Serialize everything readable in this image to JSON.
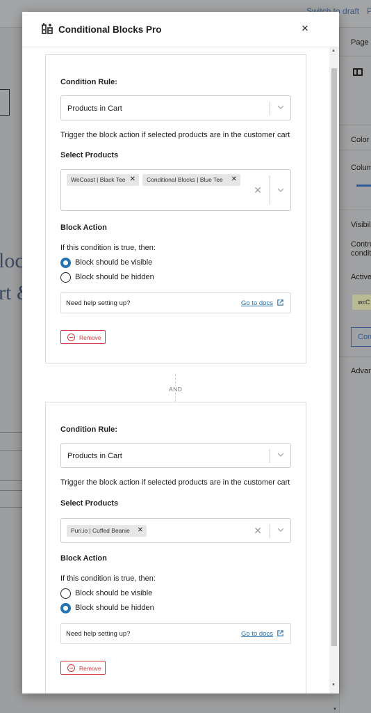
{
  "background": {
    "topbar": {
      "switch_to_draft": "Switch to draft",
      "extra": "P"
    },
    "left_fragments": [
      "loc",
      "rt &"
    ],
    "sidebar": {
      "page_tab": "Page",
      "color": "Color",
      "columns": "Colum",
      "visibility": "Visibil",
      "controls": "Contro",
      "conditions": "conditi",
      "active": "Active",
      "chip": "wcC",
      "button": "Con",
      "advanced": "Advan"
    }
  },
  "modal": {
    "title": "Conditional Blocks Pro",
    "close_label": "×",
    "and_label": "AND",
    "conditions": [
      {
        "rule_label": "Condition Rule:",
        "rule_value": "Products in Cart",
        "rule_help": "Trigger the block action if selected products are in the customer cart",
        "products_label": "Select Products",
        "products": [
          "WeCoast | Black Tee",
          "Conditional Blocks | Blue Tee"
        ],
        "action_label": "Block Action",
        "action_prompt": "If this condition is true, then:",
        "options": [
          "Block should be visible",
          "Block should be hidden"
        ],
        "selected_option": 0,
        "help_text": "Need help setting up?",
        "docs_link": "Go to docs",
        "remove_label": "Remove"
      },
      {
        "rule_label": "Condition Rule:",
        "rule_value": "Products in Cart",
        "rule_help": "Trigger the block action if selected products are in the customer cart",
        "products_label": "Select Products",
        "products": [
          "Puri.io | Cuffed Beanie"
        ],
        "action_label": "Block Action",
        "action_prompt": "If this condition is true, then:",
        "options": [
          "Block should be visible",
          "Block should be hidden"
        ],
        "selected_option": 1,
        "help_text": "Need help setting up?",
        "docs_link": "Go to docs",
        "remove_label": "Remove"
      }
    ]
  },
  "colors": {
    "accent": "#2271b1",
    "danger": "#d63638",
    "border": "#dcdcde"
  }
}
